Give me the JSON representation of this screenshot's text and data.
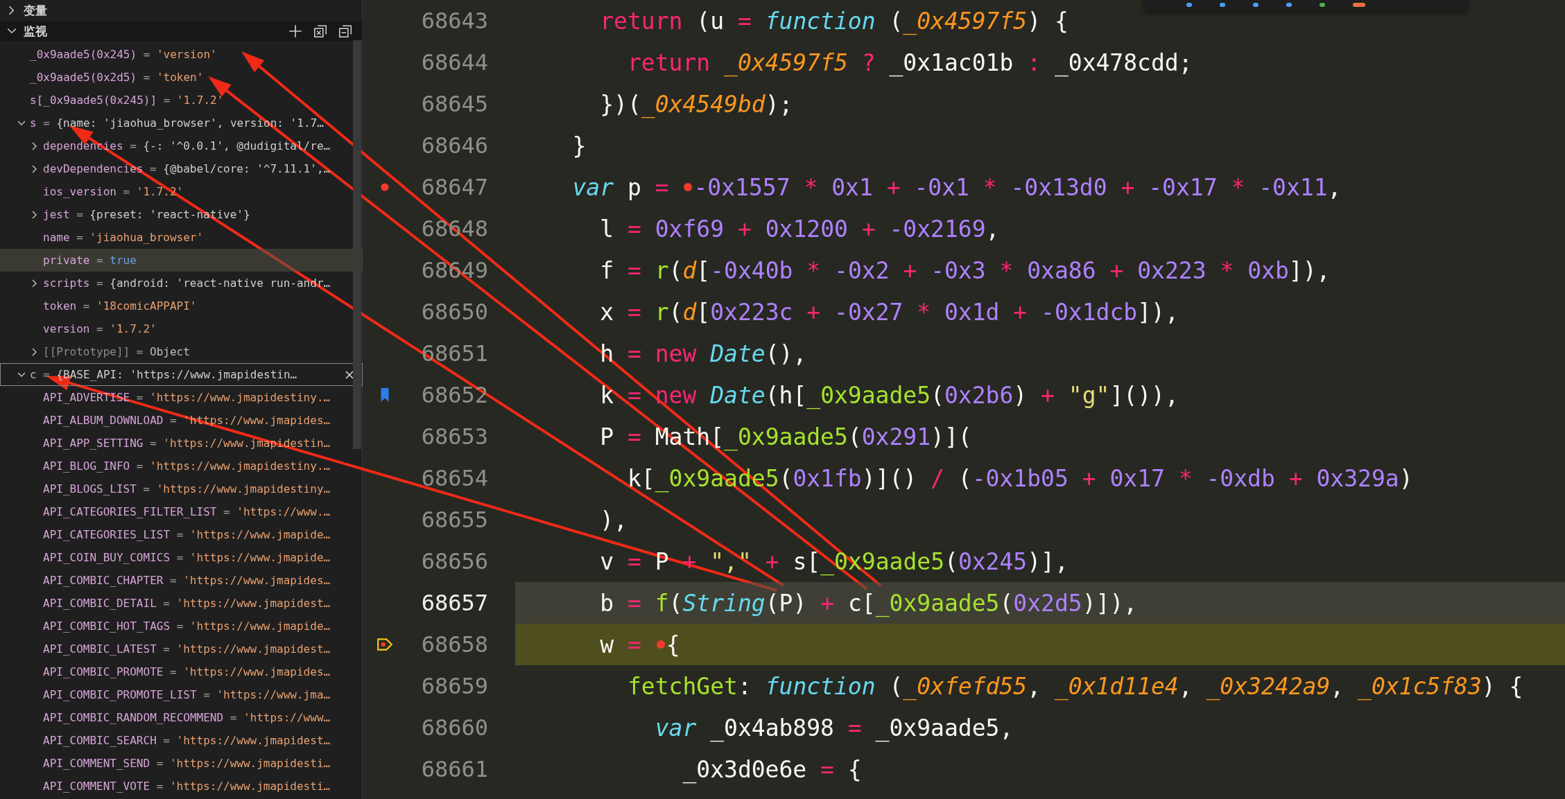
{
  "sections": [
    {
      "title": "变量",
      "expanded": false
    },
    {
      "title": "监视",
      "expanded": true
    }
  ],
  "watch": [
    {
      "name": "_0x9aade5(0x245)",
      "op": "=",
      "value": "'version'",
      "kind": "string",
      "selected": false
    },
    {
      "name": "_0x9aade5(0x2d5)",
      "op": "=",
      "value": "'token'",
      "kind": "string",
      "selected": false
    },
    {
      "name": "s[_0x9aade5(0x245)]",
      "op": "=",
      "value": "'1.7.2'",
      "kind": "string",
      "selected": false
    },
    {
      "name": "s",
      "op": "=",
      "value": "{name: 'jiaohua_browser', version: '1.7…",
      "kind": "object",
      "expanded": true,
      "selected": false,
      "children": [
        {
          "name": "dependencies",
          "op": "=",
          "value": "{-: '^0.0.1', @dudigital/re…",
          "kind": "object",
          "expanded": false,
          "hovered": false
        },
        {
          "name": "devDependencies",
          "op": "=",
          "value": "{@babel/core: '^7.11.1',…",
          "kind": "object",
          "expanded": false,
          "hovered": false
        },
        {
          "name": "ios_version",
          "op": "=",
          "value": "'1.7.2'",
          "kind": "string",
          "hovered": false
        },
        {
          "name": "jest",
          "op": "=",
          "value": "{preset: 'react-native'}",
          "kind": "object",
          "expanded": false,
          "hovered": false
        },
        {
          "name": "name",
          "op": "=",
          "value": "'jiaohua_browser'",
          "kind": "string",
          "hovered": false
        },
        {
          "name": "private",
          "op": "=",
          "value": "true",
          "kind": "bool",
          "hovered": true
        },
        {
          "name": "scripts",
          "op": "=",
          "value": "{android: 'react-native run-andr…",
          "kind": "object",
          "expanded": false,
          "hovered": false
        },
        {
          "name": "token",
          "op": "=",
          "value": "'18comicAPPAPI'",
          "kind": "string",
          "hovered": false
        },
        {
          "name": "version",
          "op": "=",
          "value": "'1.7.2'",
          "kind": "string",
          "hovered": false
        },
        {
          "name": "[[Prototype]]",
          "op": "=",
          "value": "Object",
          "kind": "proto",
          "expanded": false,
          "hovered": false
        }
      ]
    },
    {
      "name": "c",
      "op": "=",
      "value": "{BASE_API: 'https://www.jmapidestin…",
      "kind": "object",
      "expanded": true,
      "selected": true,
      "children": [
        {
          "name": "API_ADVERTISE",
          "op": "=",
          "value": "'https://www.jmapidestiny.…",
          "kind": "string"
        },
        {
          "name": "API_ALBUM_DOWNLOAD",
          "op": "=",
          "value": "'https://www.jmapides…",
          "kind": "string"
        },
        {
          "name": "API_APP_SETTING",
          "op": "=",
          "value": "'https://www.jmapidestin…",
          "kind": "string"
        },
        {
          "name": "API_BLOG_INFO",
          "op": "=",
          "value": "'https://www.jmapidestiny.…",
          "kind": "string"
        },
        {
          "name": "API_BLOGS_LIST",
          "op": "=",
          "value": "'https://www.jmapidestiny…",
          "kind": "string"
        },
        {
          "name": "API_CATEGORIES_FILTER_LIST",
          "op": "=",
          "value": "'https://www.…",
          "kind": "string"
        },
        {
          "name": "API_CATEGORIES_LIST",
          "op": "=",
          "value": "'https://www.jmapide…",
          "kind": "string"
        },
        {
          "name": "API_COIN_BUY_COMICS",
          "op": "=",
          "value": "'https://www.jmapide…",
          "kind": "string"
        },
        {
          "name": "API_COMBIC_CHAPTER",
          "op": "=",
          "value": "'https://www.jmapides…",
          "kind": "string"
        },
        {
          "name": "API_COMBIC_DETAIL",
          "op": "=",
          "value": "'https://www.jmapidest…",
          "kind": "string"
        },
        {
          "name": "API_COMBIC_HOT_TAGS",
          "op": "=",
          "value": "'https://www.jmapide…",
          "kind": "string"
        },
        {
          "name": "API_COMBIC_LATEST",
          "op": "=",
          "value": "'https://www.jmapidest…",
          "kind": "string"
        },
        {
          "name": "API_COMBIC_PROMOTE",
          "op": "=",
          "value": "'https://www.jmapides…",
          "kind": "string"
        },
        {
          "name": "API_COMBIC_PROMOTE_LIST",
          "op": "=",
          "value": "'https://www.jma…",
          "kind": "string"
        },
        {
          "name": "API_COMBIC_RANDOM_RECOMMEND",
          "op": "=",
          "value": "'https://www…",
          "kind": "string"
        },
        {
          "name": "API_COMBIC_SEARCH",
          "op": "=",
          "value": "'https://www.jmapidest…",
          "kind": "string"
        },
        {
          "name": "API_COMMENT_SEND",
          "op": "=",
          "value": "'https://www.jmapidesti…",
          "kind": "string"
        },
        {
          "name": "API_COMMENT_VOTE",
          "op": "=",
          "value": "'https://www.jmapidesti…",
          "kind": "string"
        }
      ]
    }
  ],
  "code": [
    {
      "number": "68643",
      "current": false,
      "paused": false,
      "tokens": [
        {
          "text": "      return ",
          "kind": "keyword"
        },
        {
          "text": "(u ",
          "kind": "plain"
        },
        {
          "text": "= ",
          "kind": "keyword"
        },
        {
          "text": "function ",
          "kind": "storage"
        },
        {
          "text": "(",
          "kind": "plain"
        },
        {
          "text": "_0x4597f5",
          "kind": "param"
        },
        {
          "text": ") {",
          "kind": "plain"
        }
      ]
    },
    {
      "number": "68644",
      "current": false,
      "paused": false,
      "tokens": [
        {
          "text": "        return ",
          "kind": "keyword"
        },
        {
          "text": "_0x4597f5 ",
          "kind": "param"
        },
        {
          "text": "? ",
          "kind": "keyword"
        },
        {
          "text": "_0x1ac01b ",
          "kind": "plain"
        },
        {
          "text": ": ",
          "kind": "keyword"
        },
        {
          "text": "_0x478cdd;",
          "kind": "plain"
        }
      ]
    },
    {
      "number": "68645",
      "current": false,
      "paused": false,
      "tokens": [
        {
          "text": "      })(",
          "kind": "plain"
        },
        {
          "text": "_0x4549bd",
          "kind": "param"
        },
        {
          "text": ");",
          "kind": "plain"
        }
      ]
    },
    {
      "number": "68646",
      "current": false,
      "paused": false,
      "tokens": [
        {
          "text": "    }",
          "kind": "plain"
        }
      ]
    },
    {
      "number": "68647",
      "current": false,
      "paused": false,
      "gutter_mark": {
        "kind": "breakpoint"
      },
      "tokens": [
        {
          "text": "    var ",
          "kind": "storage"
        },
        {
          "text": "p ",
          "kind": "plain"
        },
        {
          "text": "= ",
          "kind": "keyword"
        },
        {
          "kind": "inline-breakpoint"
        },
        {
          "text": "-0x1557 ",
          "kind": "number"
        },
        {
          "text": "* ",
          "kind": "keyword"
        },
        {
          "text": "0x1 ",
          "kind": "number"
        },
        {
          "text": "+ ",
          "kind": "keyword"
        },
        {
          "text": "-0x1 ",
          "kind": "number"
        },
        {
          "text": "* ",
          "kind": "keyword"
        },
        {
          "text": "-0x13d0 ",
          "kind": "number"
        },
        {
          "text": "+ ",
          "kind": "keyword"
        },
        {
          "text": "-0x17 ",
          "kind": "number"
        },
        {
          "text": "* ",
          "kind": "keyword"
        },
        {
          "text": "-0x11",
          "kind": "number"
        },
        {
          "text": ",",
          "kind": "plain"
        }
      ]
    },
    {
      "number": "68648",
      "current": false,
      "paused": false,
      "tokens": [
        {
          "text": "      l ",
          "kind": "plain"
        },
        {
          "text": "= ",
          "kind": "keyword"
        },
        {
          "text": "0xf69 ",
          "kind": "number"
        },
        {
          "text": "+ ",
          "kind": "keyword"
        },
        {
          "text": "0x1200 ",
          "kind": "number"
        },
        {
          "text": "+ ",
          "kind": "keyword"
        },
        {
          "text": "-0x2169",
          "kind": "number"
        },
        {
          "text": ",",
          "kind": "plain"
        }
      ]
    },
    {
      "number": "68649",
      "current": false,
      "paused": false,
      "tokens": [
        {
          "text": "      f ",
          "kind": "plain"
        },
        {
          "text": "= ",
          "kind": "keyword"
        },
        {
          "text": "r",
          "kind": "func"
        },
        {
          "text": "(",
          "kind": "plain"
        },
        {
          "text": "d",
          "kind": "param"
        },
        {
          "text": "[",
          "kind": "plain"
        },
        {
          "text": "-0x40b ",
          "kind": "number"
        },
        {
          "text": "* ",
          "kind": "keyword"
        },
        {
          "text": "-0x2 ",
          "kind": "number"
        },
        {
          "text": "+ ",
          "kind": "keyword"
        },
        {
          "text": "-0x3 ",
          "kind": "number"
        },
        {
          "text": "* ",
          "kind": "keyword"
        },
        {
          "text": "0xa86 ",
          "kind": "number"
        },
        {
          "text": "+ ",
          "kind": "keyword"
        },
        {
          "text": "0x223 ",
          "kind": "number"
        },
        {
          "text": "* ",
          "kind": "keyword"
        },
        {
          "text": "0xb",
          "kind": "number"
        },
        {
          "text": "]),",
          "kind": "plain"
        }
      ]
    },
    {
      "number": "68650",
      "current": false,
      "paused": false,
      "tokens": [
        {
          "text": "      x ",
          "kind": "plain"
        },
        {
          "text": "= ",
          "kind": "keyword"
        },
        {
          "text": "r",
          "kind": "func"
        },
        {
          "text": "(",
          "kind": "plain"
        },
        {
          "text": "d",
          "kind": "param"
        },
        {
          "text": "[",
          "kind": "plain"
        },
        {
          "text": "0x223c ",
          "kind": "number"
        },
        {
          "text": "+ ",
          "kind": "keyword"
        },
        {
          "text": "-0x27 ",
          "kind": "number"
        },
        {
          "text": "* ",
          "kind": "keyword"
        },
        {
          "text": "0x1d ",
          "kind": "number"
        },
        {
          "text": "+ ",
          "kind": "keyword"
        },
        {
          "text": "-0x1dcb",
          "kind": "number"
        },
        {
          "text": "]),",
          "kind": "plain"
        }
      ]
    },
    {
      "number": "68651",
      "current": false,
      "paused": false,
      "tokens": [
        {
          "text": "      h ",
          "kind": "plain"
        },
        {
          "text": "= new ",
          "kind": "keyword"
        },
        {
          "text": "Date",
          "kind": "storage"
        },
        {
          "text": "(),",
          "kind": "plain"
        }
      ]
    },
    {
      "number": "68652",
      "current": false,
      "paused": false,
      "gutter_mark": {
        "kind": "bookmark"
      },
      "tokens": [
        {
          "text": "      k ",
          "kind": "plain"
        },
        {
          "text": "= new ",
          "kind": "keyword"
        },
        {
          "text": "Date",
          "kind": "storage"
        },
        {
          "text": "(h[",
          "kind": "plain"
        },
        {
          "text": "_0x9aade5",
          "kind": "func"
        },
        {
          "text": "(",
          "kind": "plain"
        },
        {
          "text": "0x2b6",
          "kind": "number"
        },
        {
          "text": ") ",
          "kind": "plain"
        },
        {
          "text": "+ ",
          "kind": "keyword"
        },
        {
          "text": "\"g\"",
          "kind": "string"
        },
        {
          "text": "]()),",
          "kind": "plain"
        }
      ]
    },
    {
      "number": "68653",
      "current": false,
      "paused": false,
      "tokens": [
        {
          "text": "      P ",
          "kind": "plain"
        },
        {
          "text": "= ",
          "kind": "keyword"
        },
        {
          "text": "Math[",
          "kind": "plain"
        },
        {
          "text": "_0x9aade5",
          "kind": "func"
        },
        {
          "text": "(",
          "kind": "plain"
        },
        {
          "text": "0x291",
          "kind": "number"
        },
        {
          "text": ")](",
          "kind": "plain"
        }
      ]
    },
    {
      "number": "68654",
      "current": false,
      "paused": false,
      "tokens": [
        {
          "text": "        k[",
          "kind": "plain"
        },
        {
          "text": "_0x9aade5",
          "kind": "func"
        },
        {
          "text": "(",
          "kind": "plain"
        },
        {
          "text": "0x1fb",
          "kind": "number"
        },
        {
          "text": ")]() ",
          "kind": "plain"
        },
        {
          "text": "/ ",
          "kind": "keyword"
        },
        {
          "text": "(",
          "kind": "plain"
        },
        {
          "text": "-0x1b05 ",
          "kind": "number"
        },
        {
          "text": "+ ",
          "kind": "keyword"
        },
        {
          "text": "0x17 ",
          "kind": "number"
        },
        {
          "text": "* ",
          "kind": "keyword"
        },
        {
          "text": "-0xdb ",
          "kind": "number"
        },
        {
          "text": "+ ",
          "kind": "keyword"
        },
        {
          "text": "0x329a",
          "kind": "number"
        },
        {
          "text": ")",
          "kind": "plain"
        }
      ]
    },
    {
      "number": "68655",
      "current": false,
      "paused": false,
      "tokens": [
        {
          "text": "      ),",
          "kind": "plain"
        }
      ]
    },
    {
      "number": "68656",
      "current": false,
      "paused": false,
      "tokens": [
        {
          "text": "      v ",
          "kind": "plain"
        },
        {
          "text": "= ",
          "kind": "keyword"
        },
        {
          "text": "P ",
          "kind": "plain"
        },
        {
          "text": "+ ",
          "kind": "keyword"
        },
        {
          "text": "\",\" ",
          "kind": "string"
        },
        {
          "text": "+ ",
          "kind": "keyword"
        },
        {
          "text": "s[",
          "kind": "plain"
        },
        {
          "text": "_0x9aade5",
          "kind": "func"
        },
        {
          "text": "(",
          "kind": "plain"
        },
        {
          "text": "0x245",
          "kind": "number"
        },
        {
          "text": ")],",
          "kind": "plain"
        }
      ]
    },
    {
      "number": "68657",
      "current": true,
      "paused": false,
      "tokens": [
        {
          "text": "      b ",
          "kind": "plain"
        },
        {
          "text": "= ",
          "kind": "keyword"
        },
        {
          "text": "f",
          "kind": "func"
        },
        {
          "text": "(",
          "kind": "plain"
        },
        {
          "text": "String",
          "kind": "storage"
        },
        {
          "text": "(P) ",
          "kind": "plain"
        },
        {
          "text": "+ ",
          "kind": "keyword"
        },
        {
          "text": "c[",
          "kind": "plain"
        },
        {
          "text": "_0x9aade5",
          "kind": "func"
        },
        {
          "text": "(",
          "kind": "plain"
        },
        {
          "text": "0x2d5",
          "kind": "number"
        },
        {
          "text": ")]),",
          "kind": "plain"
        }
      ]
    },
    {
      "number": "68658",
      "current": false,
      "paused": true,
      "gutter_mark": {
        "kind": "paused-breakpoint"
      },
      "tokens": [
        {
          "text": "      w ",
          "kind": "plain"
        },
        {
          "text": "= ",
          "kind": "keyword"
        },
        {
          "kind": "inline-breakpoint"
        },
        {
          "text": "{",
          "kind": "plain"
        }
      ]
    },
    {
      "number": "68659",
      "current": false,
      "paused": false,
      "tokens": [
        {
          "text": "        fetchGet",
          "kind": "func"
        },
        {
          "text": ": ",
          "kind": "plain"
        },
        {
          "text": "function ",
          "kind": "storage"
        },
        {
          "text": "(",
          "kind": "plain"
        },
        {
          "text": "_0xfefd55",
          "kind": "param"
        },
        {
          "text": ", ",
          "kind": "plain"
        },
        {
          "text": "_0x1d11e4",
          "kind": "param"
        },
        {
          "text": ", ",
          "kind": "plain"
        },
        {
          "text": "_0x3242a9",
          "kind": "param"
        },
        {
          "text": ", ",
          "kind": "plain"
        },
        {
          "text": "_0x1c5f83",
          "kind": "param"
        },
        {
          "text": ") {",
          "kind": "plain"
        }
      ]
    },
    {
      "number": "68660",
      "current": false,
      "paused": false,
      "tokens": [
        {
          "text": "          var ",
          "kind": "storage"
        },
        {
          "text": "_0x4ab898 ",
          "kind": "plain"
        },
        {
          "text": "= ",
          "kind": "keyword"
        },
        {
          "text": "_0x9aade5,",
          "kind": "plain"
        }
      ]
    },
    {
      "number": "68661",
      "current": false,
      "paused": false,
      "tokens": [
        {
          "text": "            _0x3d0e6e ",
          "kind": "plain"
        },
        {
          "text": "= ",
          "kind": "keyword"
        },
        {
          "text": "{",
          "kind": "plain"
        }
      ]
    }
  ]
}
